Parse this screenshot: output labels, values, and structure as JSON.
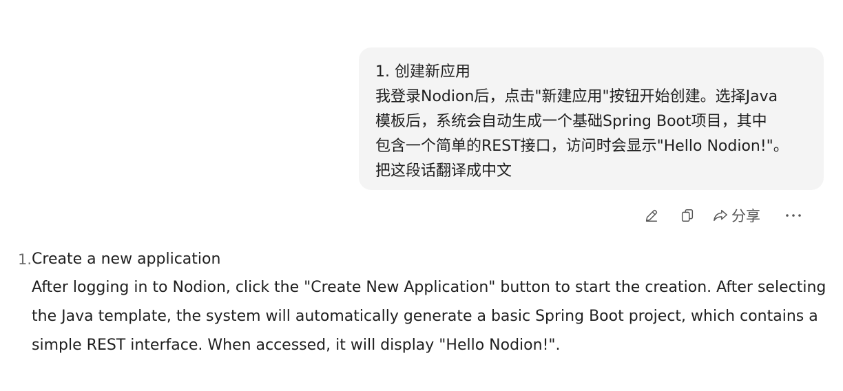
{
  "user_message": {
    "lines": [
      "1. 创建新应用",
      "我登录Nodion后，点击\"新建应用\"按钮开始创建。选择Java",
      "模板后，系统会自动生成一个基础Spring Boot项目，其中",
      "包含一个简单的REST接口，访问时会显示\"Hello Nodion!\"。",
      "把这段话翻译成中文"
    ]
  },
  "message_actions": {
    "edit_icon": "pencil-icon",
    "copy_icon": "copy-icon",
    "share_icon": "share-arrow-icon",
    "share_label": "分享",
    "more_icon": "ellipsis-icon"
  },
  "response": {
    "items": [
      {
        "number": "1.",
        "title": "Create a new application",
        "lines": [
          "After logging in to Nodion, click the \"Create New Application\" button to start the creation. After selecting",
          "the Java template, the system will automatically generate a basic Spring Boot project, which contains a",
          "simple REST interface. When accessed, it will display \"Hello Nodion!\"."
        ]
      }
    ]
  }
}
